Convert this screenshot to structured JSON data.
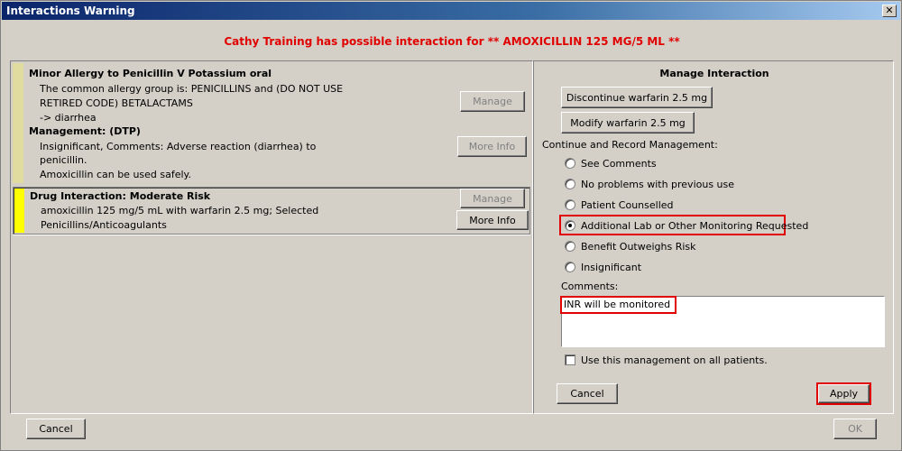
{
  "window": {
    "title": "Interactions Warning",
    "close_label": "✕"
  },
  "warning": "Cathy Training has possible interaction for ** AMOXICILLIN 125 MG/5 ML **",
  "allergy_card": {
    "title": "Minor Allergy to Penicillin V Potassium oral",
    "lines": [
      "The common allergy group is: PENICILLINS and (DO NOT USE",
      "RETIRED CODE) BETALACTAMS",
      "-> diarrhea"
    ],
    "management_heading": "Management: (DTP)",
    "management_lines": [
      "Insignificant, Comments: Adverse reaction (diarrhea) to",
      "penicillin.",
      "Amoxicillin can be used safely."
    ],
    "manage_label": "Manage",
    "more_info_label": "More Info",
    "stripe_color": "#e0dca0"
  },
  "interaction_card": {
    "title": "Drug Interaction: Moderate Risk",
    "lines": [
      "amoxicillin 125 mg/5 mL with warfarin 2.5 mg; Selected",
      "Penicillins/Anticoagulants"
    ],
    "manage_label": "Manage",
    "more_info_label": "More Info",
    "stripe_color": "#ffff00"
  },
  "manage": {
    "title": "Manage Interaction",
    "discontinue_label": "Discontinue warfarin 2.5 mg",
    "modify_label": "Modify warfarin 2.5 mg",
    "continue_label": "Continue and Record Management:",
    "options": [
      {
        "label": "See Comments",
        "checked": false
      },
      {
        "label": "No problems with previous use",
        "checked": false
      },
      {
        "label": "Patient Counselled",
        "checked": false
      },
      {
        "label": "Additional Lab or Other Monitoring Requested",
        "checked": true
      },
      {
        "label": "Benefit Outweighs Risk",
        "checked": false
      },
      {
        "label": "Insignificant",
        "checked": false
      }
    ],
    "comments_label": "Comments:",
    "comments_value": "INR will be monitored",
    "use_all_label": "Use this management on all patients.",
    "cancel_label": "Cancel",
    "apply_label": "Apply"
  },
  "footer": {
    "cancel_label": "Cancel",
    "ok_label": "OK"
  },
  "colors": {
    "title_bar": "#0a246a",
    "warning_text": "#e00000",
    "highlight": "#e00000",
    "face": "#d4d0c8"
  }
}
